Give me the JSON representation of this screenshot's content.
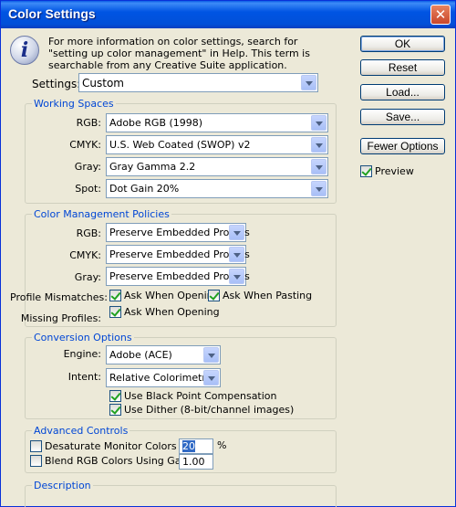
{
  "window": {
    "title": "Color Settings",
    "close_glyph": "✕"
  },
  "info": {
    "icon": "info-icon",
    "text": "For more information on color settings, search for \"setting up color management\" in Help. This term is searchable from any Creative Suite application."
  },
  "buttons": {
    "ok": "OK",
    "reset": "Reset",
    "load": "Load...",
    "save": "Save...",
    "fewer_options": "Fewer Options"
  },
  "preview": {
    "label": "Preview",
    "checked": true
  },
  "settings": {
    "label": "Settings:",
    "value": "Custom"
  },
  "working_spaces": {
    "title": "Working Spaces",
    "rgb_label": "RGB:",
    "rgb_value": "Adobe RGB (1998)",
    "cmyk_label": "CMYK:",
    "cmyk_value": "U.S. Web Coated (SWOP) v2",
    "gray_label": "Gray:",
    "gray_value": "Gray Gamma 2.2",
    "spot_label": "Spot:",
    "spot_value": "Dot Gain 20%"
  },
  "policies": {
    "title": "Color Management Policies",
    "rgb_label": "RGB:",
    "rgb_value": "Preserve Embedded Profiles",
    "cmyk_label": "CMYK:",
    "cmyk_value": "Preserve Embedded Profiles",
    "gray_label": "Gray:",
    "gray_value": "Preserve Embedded Profiles",
    "mismatches_label": "Profile Mismatches:",
    "ask_opening": "Ask When Opening",
    "ask_pasting": "Ask When Pasting",
    "missing_label": "Missing Profiles:",
    "missing_ask_opening": "Ask When Opening"
  },
  "conversion": {
    "title": "Conversion Options",
    "engine_label": "Engine:",
    "engine_value": "Adobe (ACE)",
    "intent_label": "Intent:",
    "intent_value": "Relative Colorimetric",
    "black_point": "Use Black Point Compensation",
    "dither": "Use Dither (8-bit/channel images)"
  },
  "advanced": {
    "title": "Advanced Controls",
    "desaturate_label": "Desaturate Monitor Colors By:",
    "desaturate_value": "20",
    "percent": "%",
    "blend_label": "Blend RGB Colors Using Gamma:",
    "blend_value": "1.00"
  },
  "description": {
    "title": "Description"
  },
  "colors": {
    "titlebar": "#0054e3",
    "dialog": "#ece9d8",
    "group_title": "#0046d5"
  }
}
